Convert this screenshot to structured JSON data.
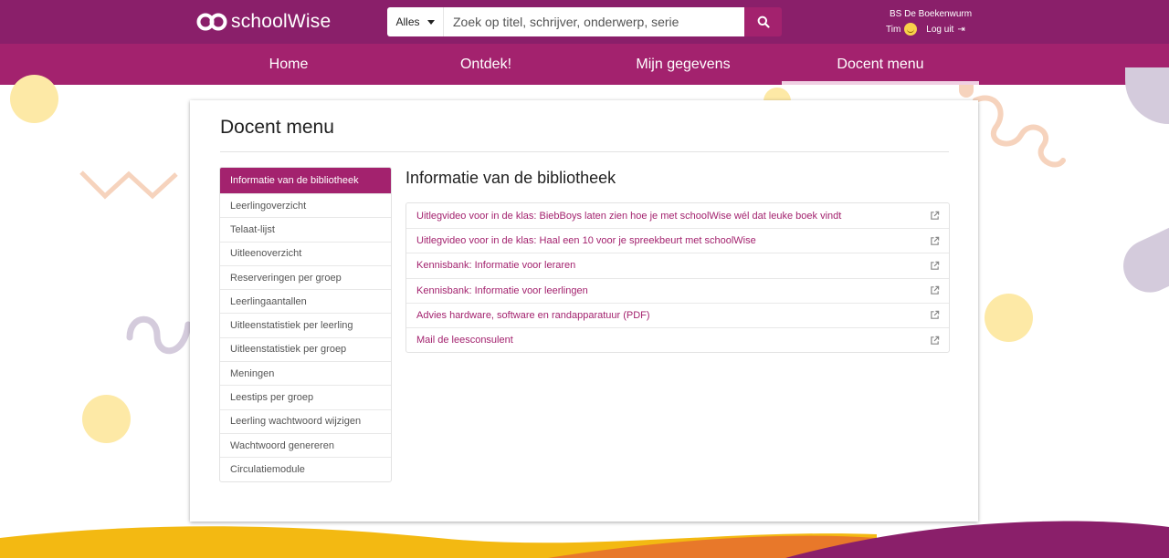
{
  "brand": {
    "name": "schoolWise",
    "logo_icon": "infinity-logo-icon"
  },
  "search": {
    "scope_label": "Alles",
    "placeholder": "Zoek op titel, schrijver, onderwerp, serie",
    "value": "",
    "button_icon": "search-icon"
  },
  "user": {
    "school": "BS De Boekenwurm",
    "name": "Tim",
    "avatar_icon": "smiley-icon",
    "logout_label": "Log uit",
    "logout_icon": "sign-out-icon"
  },
  "nav": {
    "items": [
      {
        "label": "Home"
      },
      {
        "label": "Ontdek!"
      },
      {
        "label": "Mijn gegevens"
      },
      {
        "label": "Docent menu"
      }
    ],
    "active": "Docent menu"
  },
  "page": {
    "title": "Docent menu",
    "section_title": "Informatie van de bibliotheek"
  },
  "sidebar": {
    "items": [
      {
        "label": "Informatie van de bibliotheek"
      },
      {
        "label": "Leerlingoverzicht"
      },
      {
        "label": "Telaat-lijst"
      },
      {
        "label": "Uitleenoverzicht"
      },
      {
        "label": "Reserveringen per groep"
      },
      {
        "label": "Leerlingaantallen"
      },
      {
        "label": "Uitleenstatistiek per leerling"
      },
      {
        "label": "Uitleenstatistiek per groep"
      },
      {
        "label": "Meningen"
      },
      {
        "label": "Leestips per groep"
      },
      {
        "label": "Leerling wachtwoord wijzigen"
      },
      {
        "label": "Wachtwoord genereren"
      },
      {
        "label": "Circulatiemodule"
      }
    ],
    "active": "Informatie van de bibliotheek"
  },
  "links": {
    "items": [
      {
        "label": "Uitlegvideo voor in de klas: BiebBoys laten zien hoe je met schoolWise wél dat leuke boek vindt"
      },
      {
        "label": "Uitlegvideo voor in de klas: Haal een 10 voor je spreekbeurt met schoolWise"
      },
      {
        "label": "Kennisbank: Informatie voor leraren"
      },
      {
        "label": "Kennisbank: Informatie voor leerlingen"
      },
      {
        "label": "Advies hardware, software en randapparatuur (PDF)"
      },
      {
        "label": "Mail de leesconsulent"
      }
    ],
    "link_icon": "external-link-icon"
  },
  "colors": {
    "topbar": "#8a1f6a",
    "navbar": "#a3226e",
    "accent": "#a3226e",
    "deco_yellow": "#fde9a6",
    "deco_peach": "#f6d3bd",
    "deco_lavender": "#d4cbdc",
    "wave_purple": "#8a1f6a",
    "wave_orange": "#e8782a",
    "wave_yellow": "#f3b912"
  }
}
